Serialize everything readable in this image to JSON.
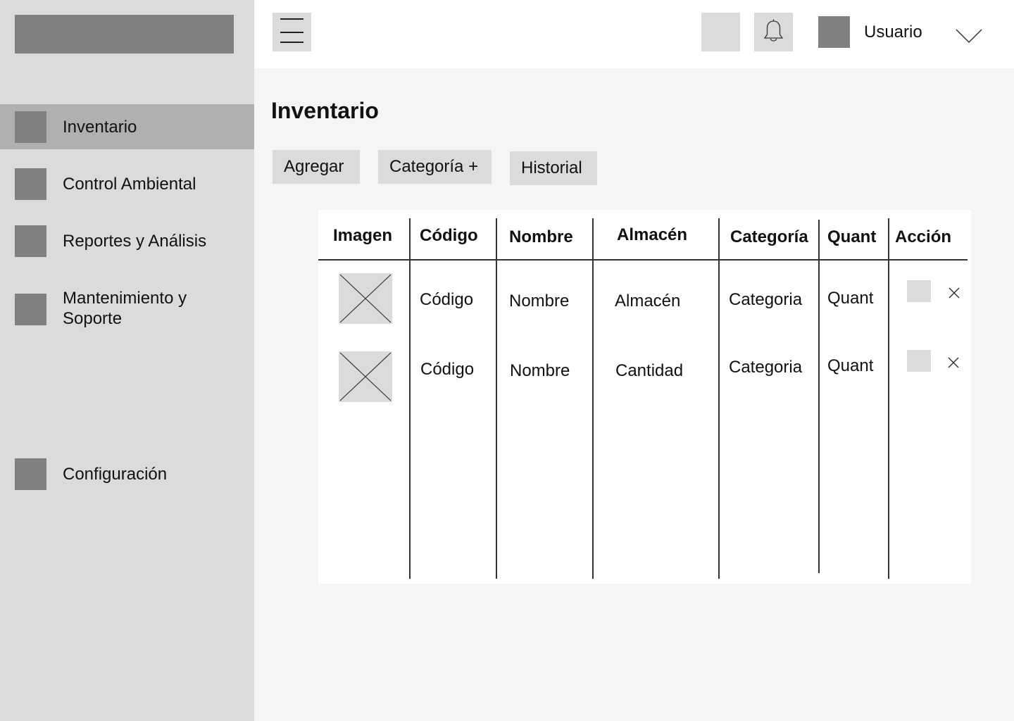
{
  "sidebar": {
    "items": [
      {
        "label": "Inventario",
        "active": true
      },
      {
        "label": "Control Ambiental"
      },
      {
        "label": "Reportes y Análisis"
      },
      {
        "label": "Mantenimiento y Soporte"
      },
      {
        "label": "Configuración"
      }
    ]
  },
  "header": {
    "user_name": "Usuario"
  },
  "main": {
    "title": "Inventario",
    "buttons": {
      "add": "Agregar",
      "category": "Categoría +",
      "history": "Historial"
    },
    "table": {
      "columns": [
        "Imagen",
        "Código",
        "Nombre",
        "Almacén",
        "Categoría",
        "Quant",
        "Acción"
      ],
      "rows": [
        {
          "codigo": "Código",
          "nombre": "Nombre",
          "almacen": "Almacén",
          "categoria": "Categoria",
          "quant": "Quant"
        },
        {
          "codigo": "Código",
          "nombre": "Nombre",
          "almacen": "Cantidad",
          "categoria": "Categoria",
          "quant": "Quant"
        }
      ]
    }
  },
  "colors": {
    "sidebar_bg": "#dbdbdb",
    "active_item_bg": "#b0b0b0",
    "placeholder_dark": "#808080",
    "placeholder_light": "#dbdbdb",
    "content_bg": "#f5f5f5"
  },
  "icons": {
    "menu": "hamburger-icon",
    "notifications": "bell-icon",
    "dropdown": "chevron-down-icon",
    "delete": "close-icon",
    "image_placeholder": "image-placeholder-icon"
  }
}
